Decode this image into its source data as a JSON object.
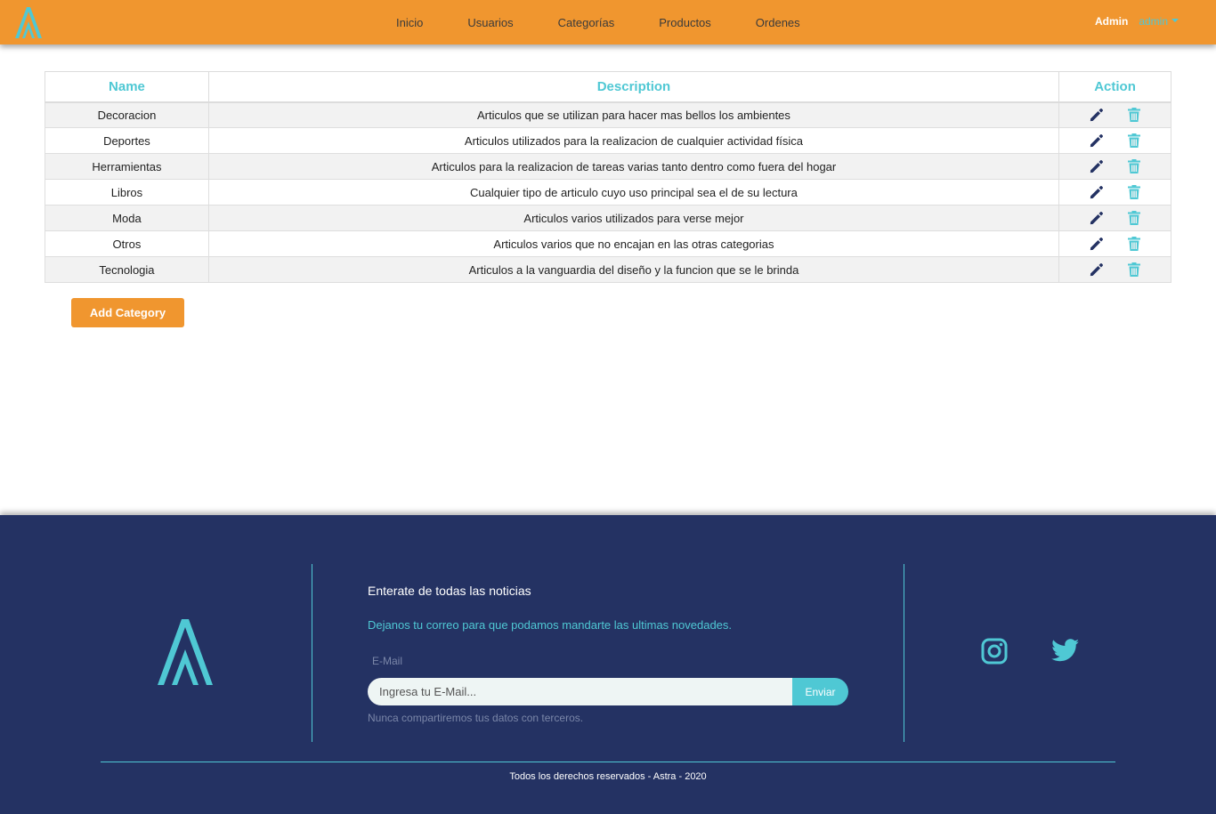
{
  "navbar": {
    "links": [
      "Inicio",
      "Usuarios",
      "Categorías",
      "Productos",
      "Ordenes"
    ],
    "user_role": "Admin",
    "user_name": "admin",
    "colors": {
      "background": "#f0962f",
      "accent": "#4fc8d4"
    }
  },
  "table": {
    "headers": {
      "name": "Name",
      "description": "Description",
      "action": "Action"
    },
    "rows": [
      {
        "name": "Decoracion",
        "description": "Articulos que se utilizan para hacer mas bellos los ambientes"
      },
      {
        "name": "Deportes",
        "description": "Articulos utilizados para la realizacion de cualquier actividad física"
      },
      {
        "name": "Herramientas",
        "description": "Articulos para la realizacion de tareas varias tanto dentro como fuera del hogar"
      },
      {
        "name": "Libros",
        "description": "Cualquier tipo de articulo cuyo uso principal sea el de su lectura"
      },
      {
        "name": "Moda",
        "description": "Articulos varios utilizados para verse mejor"
      },
      {
        "name": "Otros",
        "description": "Articulos varios que no encajan en las otras categorias"
      },
      {
        "name": "Tecnologia",
        "description": "Articulos a la vanguardia del diseño y la funcion que se le brinda"
      }
    ],
    "row_icons": {
      "edit": "pencil-icon",
      "delete": "trash-icon"
    }
  },
  "add_button": {
    "label": "Add Category"
  },
  "footer": {
    "title": "Enterate de todas las noticias",
    "subtitle": "Dejanos tu correo para que podamos mandarte las ultimas novedades.",
    "email_label": "E-Mail",
    "email_placeholder": "Ingresa tu E-Mail...",
    "submit_label": "Enviar",
    "help_text": "Nunca compartiremos tus datos con terceros.",
    "social_icons": [
      "instagram-icon",
      "twitter-icon"
    ],
    "copyright": "Todos los derechos reservados - Astra - 2020",
    "colors": {
      "background": "#243263",
      "accent": "#4fc8d4"
    }
  }
}
